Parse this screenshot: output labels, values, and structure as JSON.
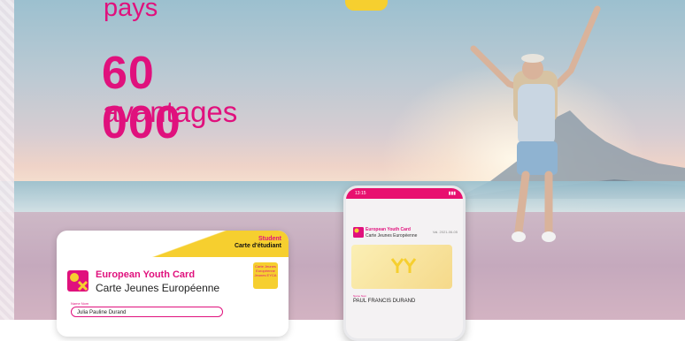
{
  "headline": {
    "line1": "pays",
    "number": "60 000",
    "line3": "avantages"
  },
  "card": {
    "student": "Student",
    "carte_etudiant": "Carte d'étudiant",
    "title_en": "European Youth Card",
    "title_fr": "Carte Jeunes Européenne",
    "badge_text": "Carte Jeunes Européenne Jeunes EYCA",
    "field_label": "Name Nom",
    "field_value": "Julia Pauline Durand"
  },
  "phone": {
    "time": "13:15",
    "title_en": "European Youth Card",
    "title_fr": "Carte Jeunes Européenne",
    "valid": "Val. 2021-06-05",
    "name_label": "Name Nom",
    "name": "PAUL FRANCIS DURAND"
  },
  "colors": {
    "brand_pink": "#e0117d",
    "brand_yellow": "#f6cf2f"
  }
}
